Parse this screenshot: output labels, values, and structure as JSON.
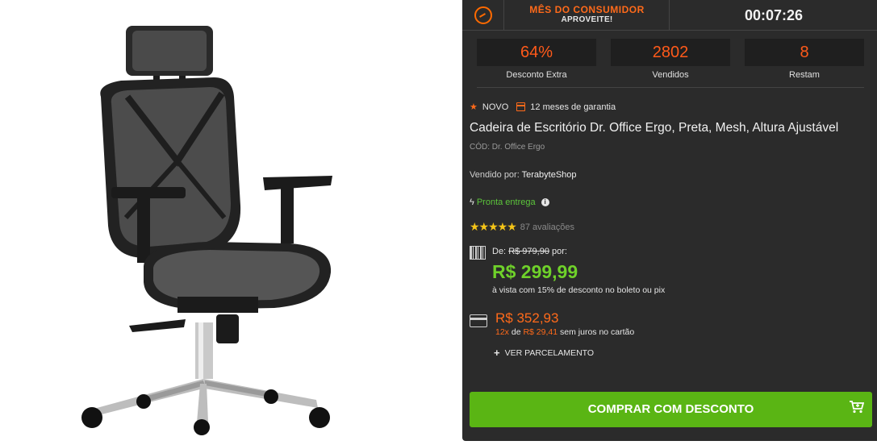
{
  "promo": {
    "title": "MÊS DO CONSUMIDOR",
    "subtitle": "APROVEITE!",
    "countdown": "00:07:26"
  },
  "stats": [
    {
      "value": "64%",
      "label": "Desconto Extra"
    },
    {
      "value": "2802",
      "label": "Vendidos"
    },
    {
      "value": "8",
      "label": "Restam"
    }
  ],
  "badges": {
    "new": "NOVO",
    "warranty": "12 meses de garantia"
  },
  "product": {
    "title": "Cadeira de Escritório Dr. Office Ergo, Preta, Mesh, Altura Ajustável",
    "code": "CÓD: Dr. Office Ergo",
    "seller_label": "Vendido por:",
    "seller_name": "TerabyteShop",
    "stock": "Pronta entrega",
    "rating_count": "87 avaliações",
    "rating_stars": 5
  },
  "pricing": {
    "old_prefix": "De:",
    "old_price": "R$ 979,90",
    "old_suffix": "por:",
    "pix_price": "R$ 299,99",
    "pix_note": "à vista com 15% de desconto no boleto ou pix",
    "card_price": "R$ 352,93",
    "installments_count": "12x",
    "installments_de": "de",
    "installments_value": "R$ 29,41",
    "installments_note": "sem juros no cartão",
    "see_installments": "VER PARCELAMENTO"
  },
  "cta": {
    "label": "COMPRAR COM DESCONTO"
  },
  "colors": {
    "accent_orange": "#ff6a1a",
    "price_green": "#6fd12a",
    "button_green": "#5ab514",
    "panel_bg": "#2b2b2b",
    "stars": "#f5c518"
  },
  "icons": [
    "clock-icon",
    "star-icon",
    "calendar-icon",
    "bolt-icon",
    "info-icon",
    "barcode-icon",
    "credit-card-icon",
    "plus-icon",
    "cart-icon"
  ]
}
